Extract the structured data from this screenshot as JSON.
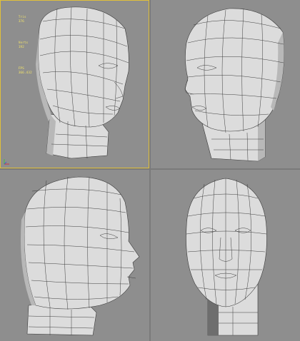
{
  "viewports": [
    {
      "id": "perspective-left",
      "active": true,
      "stats": [
        {
          "label": "Tris",
          "value": "376"
        },
        {
          "label": "Verts",
          "value": "192"
        },
        {
          "label": "FPS",
          "value": "366.432"
        }
      ]
    },
    {
      "id": "perspective-right",
      "active": false
    },
    {
      "id": "left-side",
      "active": false
    },
    {
      "id": "front",
      "active": false
    }
  ],
  "colors": {
    "background": "#8e8e8e",
    "mesh_fill": "#dcdcdc",
    "wire": "#3a3a3a",
    "stats_text": "#f0e26a",
    "active_border": "#e0c03a"
  },
  "icons": {
    "axis_gizmo": "xyz-axis-icon"
  }
}
